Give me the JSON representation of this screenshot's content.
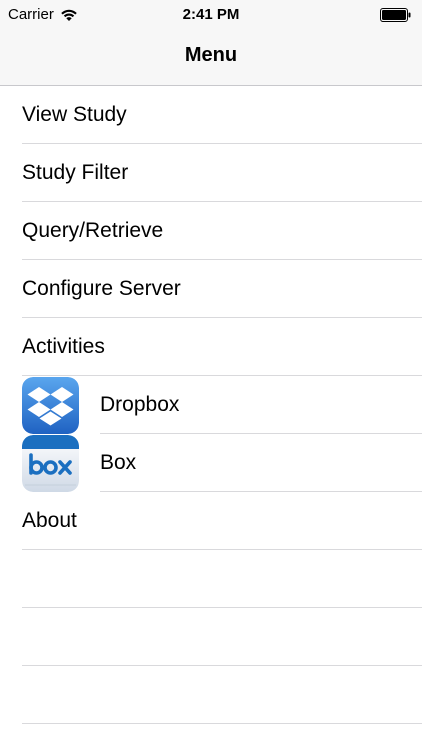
{
  "status_bar": {
    "carrier": "Carrier",
    "time": "2:41 PM"
  },
  "nav": {
    "title": "Menu"
  },
  "menu": {
    "items": [
      {
        "label": "View Study"
      },
      {
        "label": "Study Filter"
      },
      {
        "label": "Query/Retrieve"
      },
      {
        "label": "Configure Server"
      },
      {
        "label": "Activities"
      },
      {
        "label": "Dropbox",
        "icon": "dropbox-icon"
      },
      {
        "label": "Box",
        "icon": "box-icon"
      },
      {
        "label": "About"
      }
    ]
  },
  "colors": {
    "bar_bg": "#f7f7f7",
    "separator": "#d9d9dc",
    "dropbox_blue": "#2f7fd8",
    "box_blue": "#1b6fc0"
  }
}
